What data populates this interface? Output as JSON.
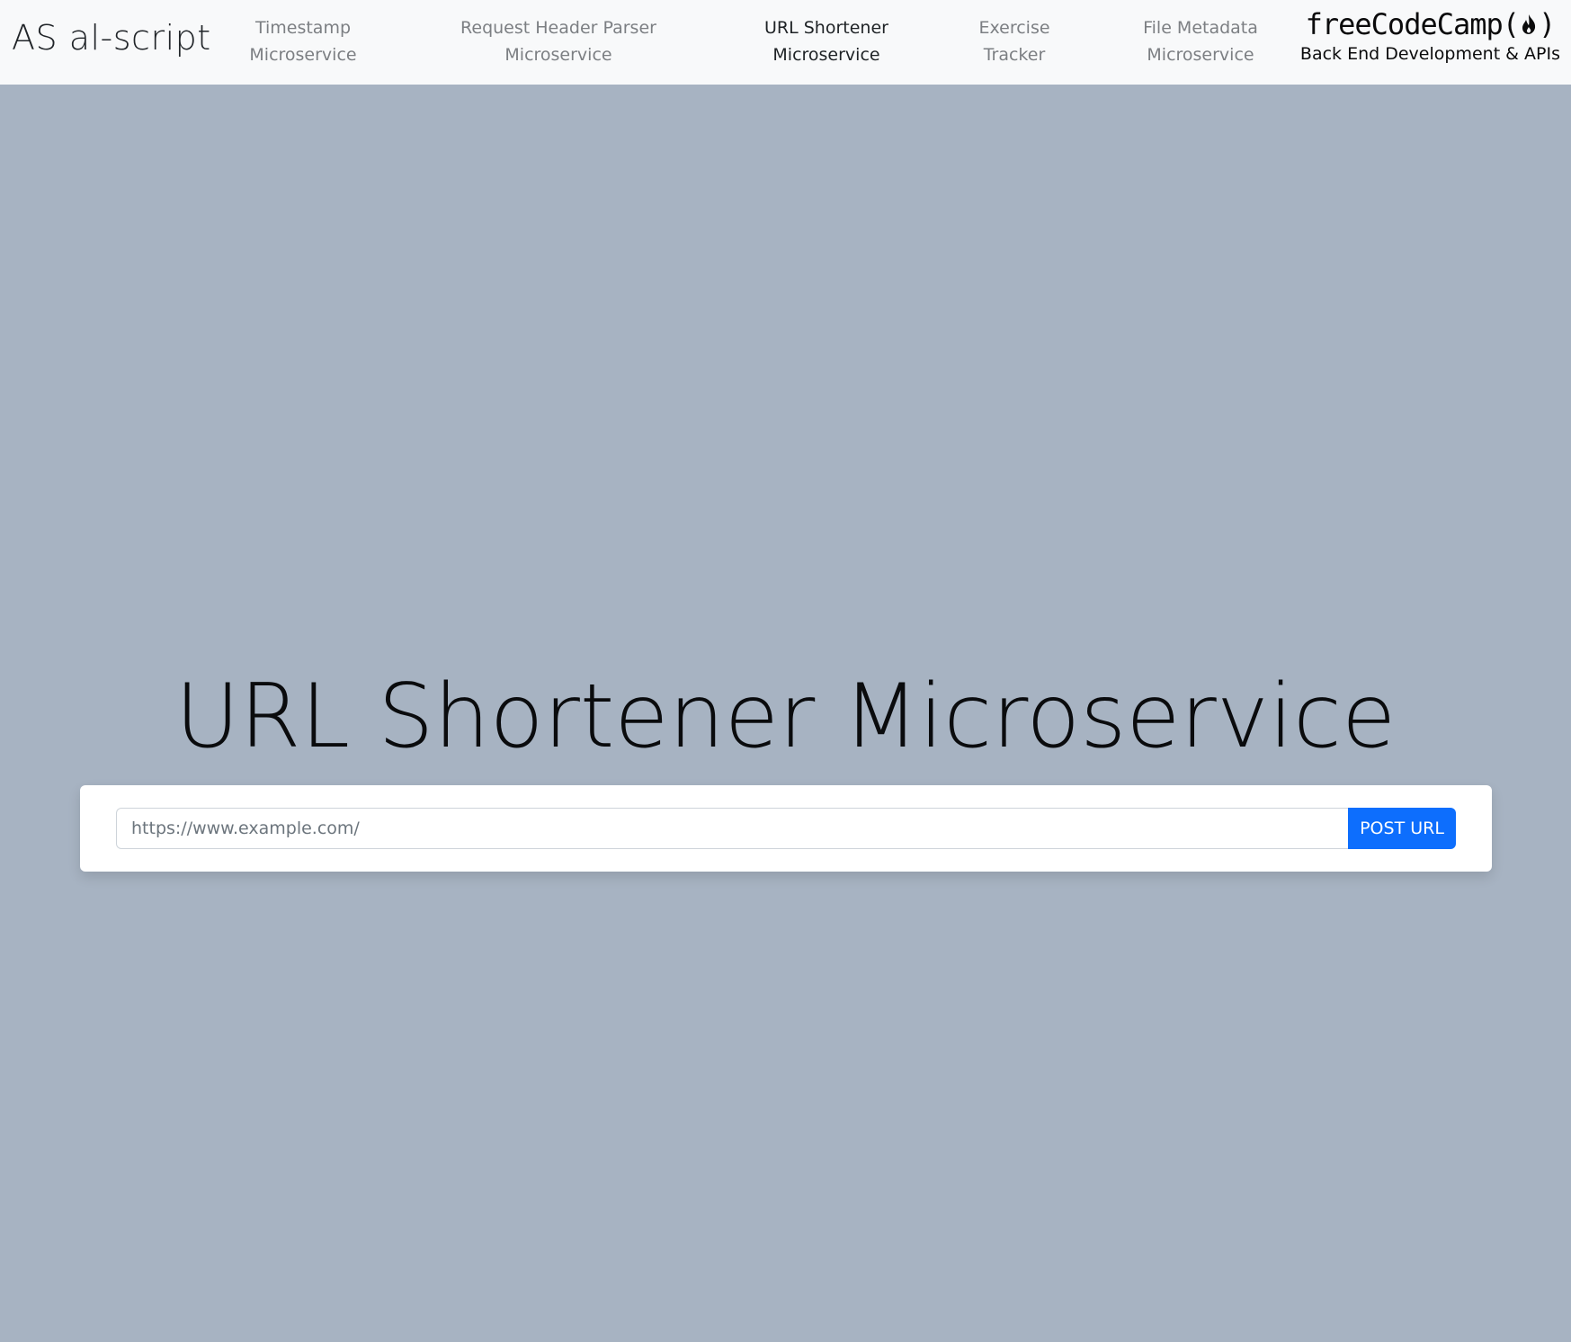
{
  "navbar": {
    "brand": "AS al-script",
    "links": [
      {
        "line1": "Timestamp",
        "line2": "Microservice",
        "active": false
      },
      {
        "line1": "Request Header Parser",
        "line2": "Microservice",
        "active": false
      },
      {
        "line1": "URL Shortener",
        "line2": "Microservice",
        "active": true
      },
      {
        "line1": "Exercise",
        "line2": "Tracker",
        "active": false
      },
      {
        "line1": "File Metadata",
        "line2": "Microservice",
        "active": false
      }
    ],
    "fcc": {
      "logo_text_left": "freeCodeCamp(",
      "logo_text_right": ")",
      "subtitle": "Back End Development & APIs"
    }
  },
  "main": {
    "heading": "URL Shortener Microservice",
    "form": {
      "input_placeholder": "https://www.example.com/",
      "input_value": "",
      "submit_label": "POST URL"
    }
  },
  "colors": {
    "background": "#a7b3c2",
    "navbar": "#f8f9fa",
    "primary_button": "#0d6efd"
  }
}
